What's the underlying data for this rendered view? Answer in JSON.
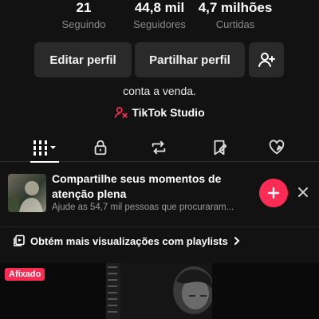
{
  "stats": [
    {
      "value": "21",
      "label": "Seguindo"
    },
    {
      "value": "44,8 mil",
      "label": "Seguidores"
    },
    {
      "value": "4,7 milhões",
      "label": "Curtidas"
    }
  ],
  "actions": {
    "edit_label": "Editar perfil",
    "share_label": "Partilhar perfil",
    "add_friend_icon": "add-user-icon"
  },
  "bio": "conta a venda.",
  "studio": {
    "label": "TikTok Studio",
    "icon": "tiktok-studio-icon",
    "icon_color": "#fe2c55"
  },
  "tabs": [
    {
      "icon": "grid-icon",
      "active": true
    },
    {
      "icon": "lock-icon"
    },
    {
      "icon": "repost-icon"
    },
    {
      "icon": "saved-icon"
    },
    {
      "icon": "liked-icon"
    }
  ],
  "promo": {
    "title": "Compartilhe seus momentos de atenção plena",
    "subtitle": "Ajude as 54,7 mil pessoas que procuraram...",
    "plus_color": "#fe2c55"
  },
  "playlists_label": "Obtém mais visualizações com playlists",
  "videos": {
    "pinned_label": "Afixado"
  }
}
